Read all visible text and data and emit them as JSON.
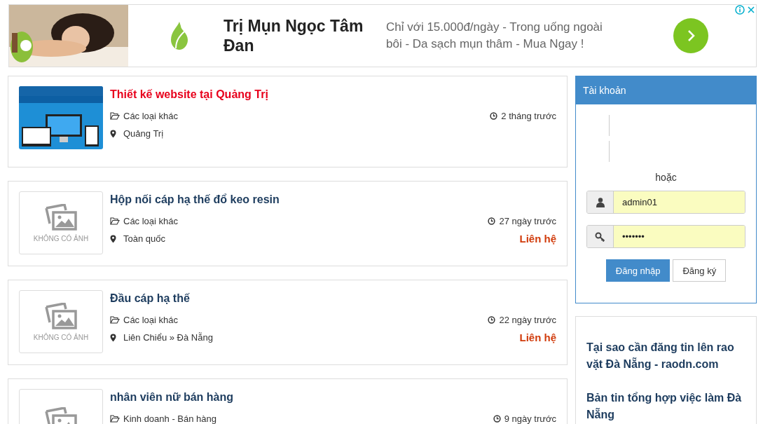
{
  "ad": {
    "title": "Trị Mụn Ngọc Tâm Đan",
    "text": "Chỉ với 15.000đ/ngày - Trong uống ngoài bôi - Da sạch mụn thâm - Mua Ngay !"
  },
  "listings": [
    {
      "title": "Thiết kế website tại Quảng Trị",
      "highlighted": true,
      "category": "Các loại khác",
      "location": "Quảng Trị",
      "time": "2 tháng trước"
    },
    {
      "kind": "placeholder",
      "no_image": "KHÔNG CÓ ẢNH",
      "title": "Hộp nối cáp hạ thế đổ keo resin",
      "highlighted": false,
      "category": "Các loại khác",
      "location": "Toàn quốc",
      "time": "27 ngày trước",
      "price": "Liên hệ"
    },
    {
      "kind": "placeholder",
      "no_image": "KHÔNG CÓ ẢNH",
      "title": "Đầu cáp hạ thế",
      "highlighted": false,
      "category": "Các loại khác",
      "location": "Liên Chiểu » Đà Nẵng",
      "time": "22 ngày trước",
      "price": "Liên hệ"
    },
    {
      "kind": "placeholder",
      "title": "nhân viên nữ bán hàng",
      "highlighted": false,
      "category": "Kinh doanh - Bán hàng",
      "time": "9 ngày trước"
    }
  ],
  "login": {
    "title": "Tài khoản",
    "or": "hoặc",
    "username": "admin01",
    "password": "•••••••",
    "buttons": [
      {
        "label": "Đăng nhập",
        "primary": true
      },
      {
        "label": "Đăng ký",
        "primary": false
      }
    ]
  },
  "links": [
    "Tại sao cần đăng tin lên rao vặt Đà Nẵng - raodn.com",
    "Bản tin tổng hợp việc làm Đà Nẵng"
  ]
}
